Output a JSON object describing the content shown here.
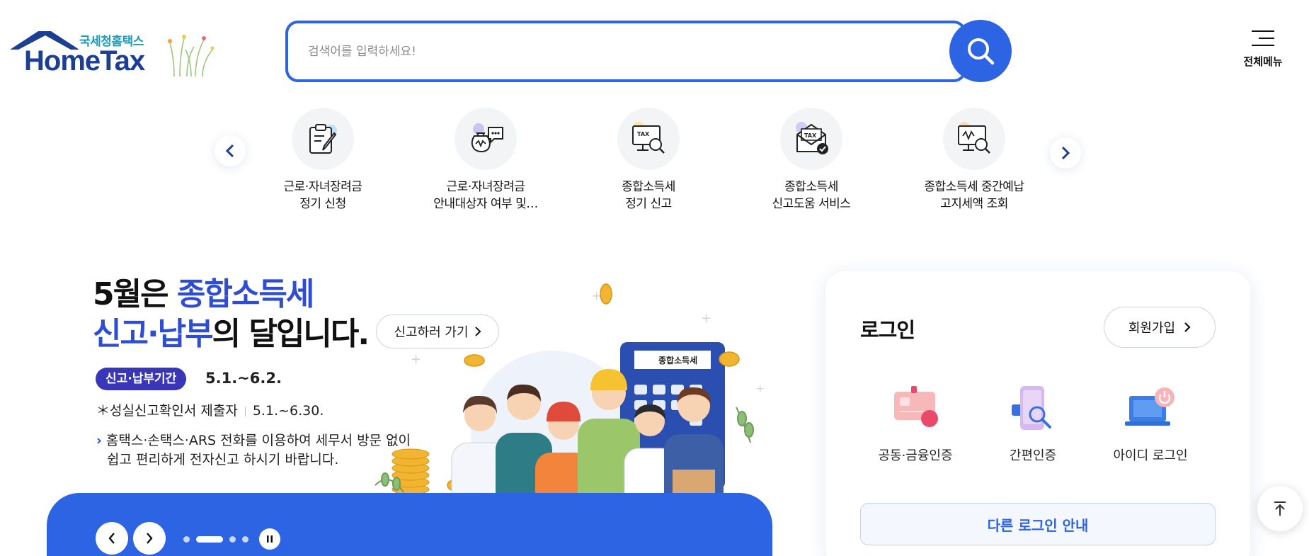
{
  "header": {
    "logo_sub": "국세청홈택스",
    "logo_main": "HomeTax",
    "search_placeholder": "검색어를 입력하세요!",
    "search_icon": "search-icon",
    "all_menu_label": "전체메뉴"
  },
  "quick_menu": {
    "items": [
      {
        "line1": "근로·자녀장려금",
        "line2": "정기 신청",
        "icon": "clipboard-pen-icon"
      },
      {
        "line1": "근로·자녀장려금",
        "line2": "안내대상자 여부 및…",
        "icon": "money-bag-chat-icon"
      },
      {
        "line1": "종합소득세",
        "line2": "정기 신고",
        "icon": "tax-monitor-search-icon"
      },
      {
        "line1": "종합소득세",
        "line2": "신고도움 서비스",
        "icon": "tax-envelope-check-icon"
      },
      {
        "line1": "종합소득세 중간예납",
        "line2": "고지세액 조회",
        "icon": "monitor-won-search-icon"
      }
    ]
  },
  "banner": {
    "title_l1_a": "5월은 ",
    "title_l1_b": "종합소득세",
    "title_l2_a": "신고·납부",
    "title_l2_b": "의 달입니다.",
    "go_button": "신고하러 가기",
    "period_badge": "신고·납부기간",
    "period_value": "5.1.~6.2.",
    "line2_label": "＊성실신고확인서 제출자",
    "line2_value": "5.1.~6.30.",
    "line3_a": "홈택스·손택스·ARS 전화를 이용하여 세무서 방문 없이",
    "line3_b": "쉽고 편리하게 전자신고 하시기 바랍니다.",
    "calculator_label": "종합소득세",
    "slide_count": 4,
    "active_slide": 2
  },
  "login": {
    "title": "로그인",
    "join_label": "회원가입",
    "options": [
      {
        "label": "공동·금융인증",
        "icon": "certificate-card-icon"
      },
      {
        "label": "간편인증",
        "icon": "phone-search-icon"
      },
      {
        "label": "아이디 로그인",
        "icon": "laptop-power-icon"
      }
    ],
    "other_login": "다른 로그인 안내"
  },
  "colors": {
    "brand_blue": "#2d64e3",
    "title_blue": "#2f4dd1",
    "badge_purple": "#3a36b8",
    "logo_navy": "#1c3f94"
  }
}
